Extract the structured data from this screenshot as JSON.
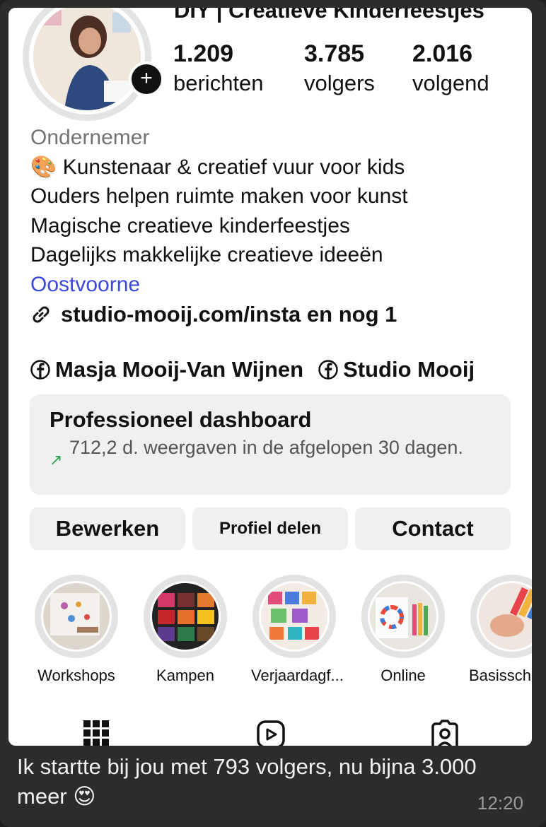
{
  "profile": {
    "name": "DIY | Creatieve Kinderfeestjes",
    "stats": [
      {
        "value": "1.209",
        "label": "berichten"
      },
      {
        "value": "3.785",
        "label": "volgers"
      },
      {
        "value": "2.016",
        "label": "volgend"
      }
    ],
    "category": "Ondernemer",
    "bio": [
      "Kunstenaar & creatief vuur voor kids",
      "Ouders helpen ruimte maken voor kunst",
      "Magische creatieve kinderfeestjes",
      "Dagelijks makkelijke creatieve ideeën"
    ],
    "location": "Oostvoorne",
    "website": "studio-mooij.com/insta en nog 1",
    "facebook": [
      "Masja Mooij-Van Wijnen",
      "Studio Mooij"
    ]
  },
  "dashboard": {
    "title": "Professioneel dashboard",
    "subtitle": "712,2 d. weergaven in de afgelopen 30 dagen."
  },
  "buttons": {
    "edit": "Bewerken",
    "share": "Profiel delen",
    "contact": "Contact"
  },
  "highlights": [
    "Workshops",
    "Kampen",
    "Verjaardagf...",
    "Online",
    "Basissch"
  ],
  "message": {
    "text": "Ik startte bij jou met 793 volgers, nu bijna 3.000 meer",
    "emoji": "😍",
    "time": "12:20"
  },
  "icons": [
    "add-story-icon",
    "palette-icon",
    "link-icon",
    "facebook-icon",
    "trend-up-icon",
    "grid-icon",
    "reels-icon",
    "tagged-icon",
    "heart-eyes-emoji-icon"
  ],
  "colors": {
    "location_link": "#3b48e0",
    "panel_background": "#eff0f2",
    "chat_bubble": "#2c2c2c",
    "timestamp": "#9b9b9b"
  }
}
